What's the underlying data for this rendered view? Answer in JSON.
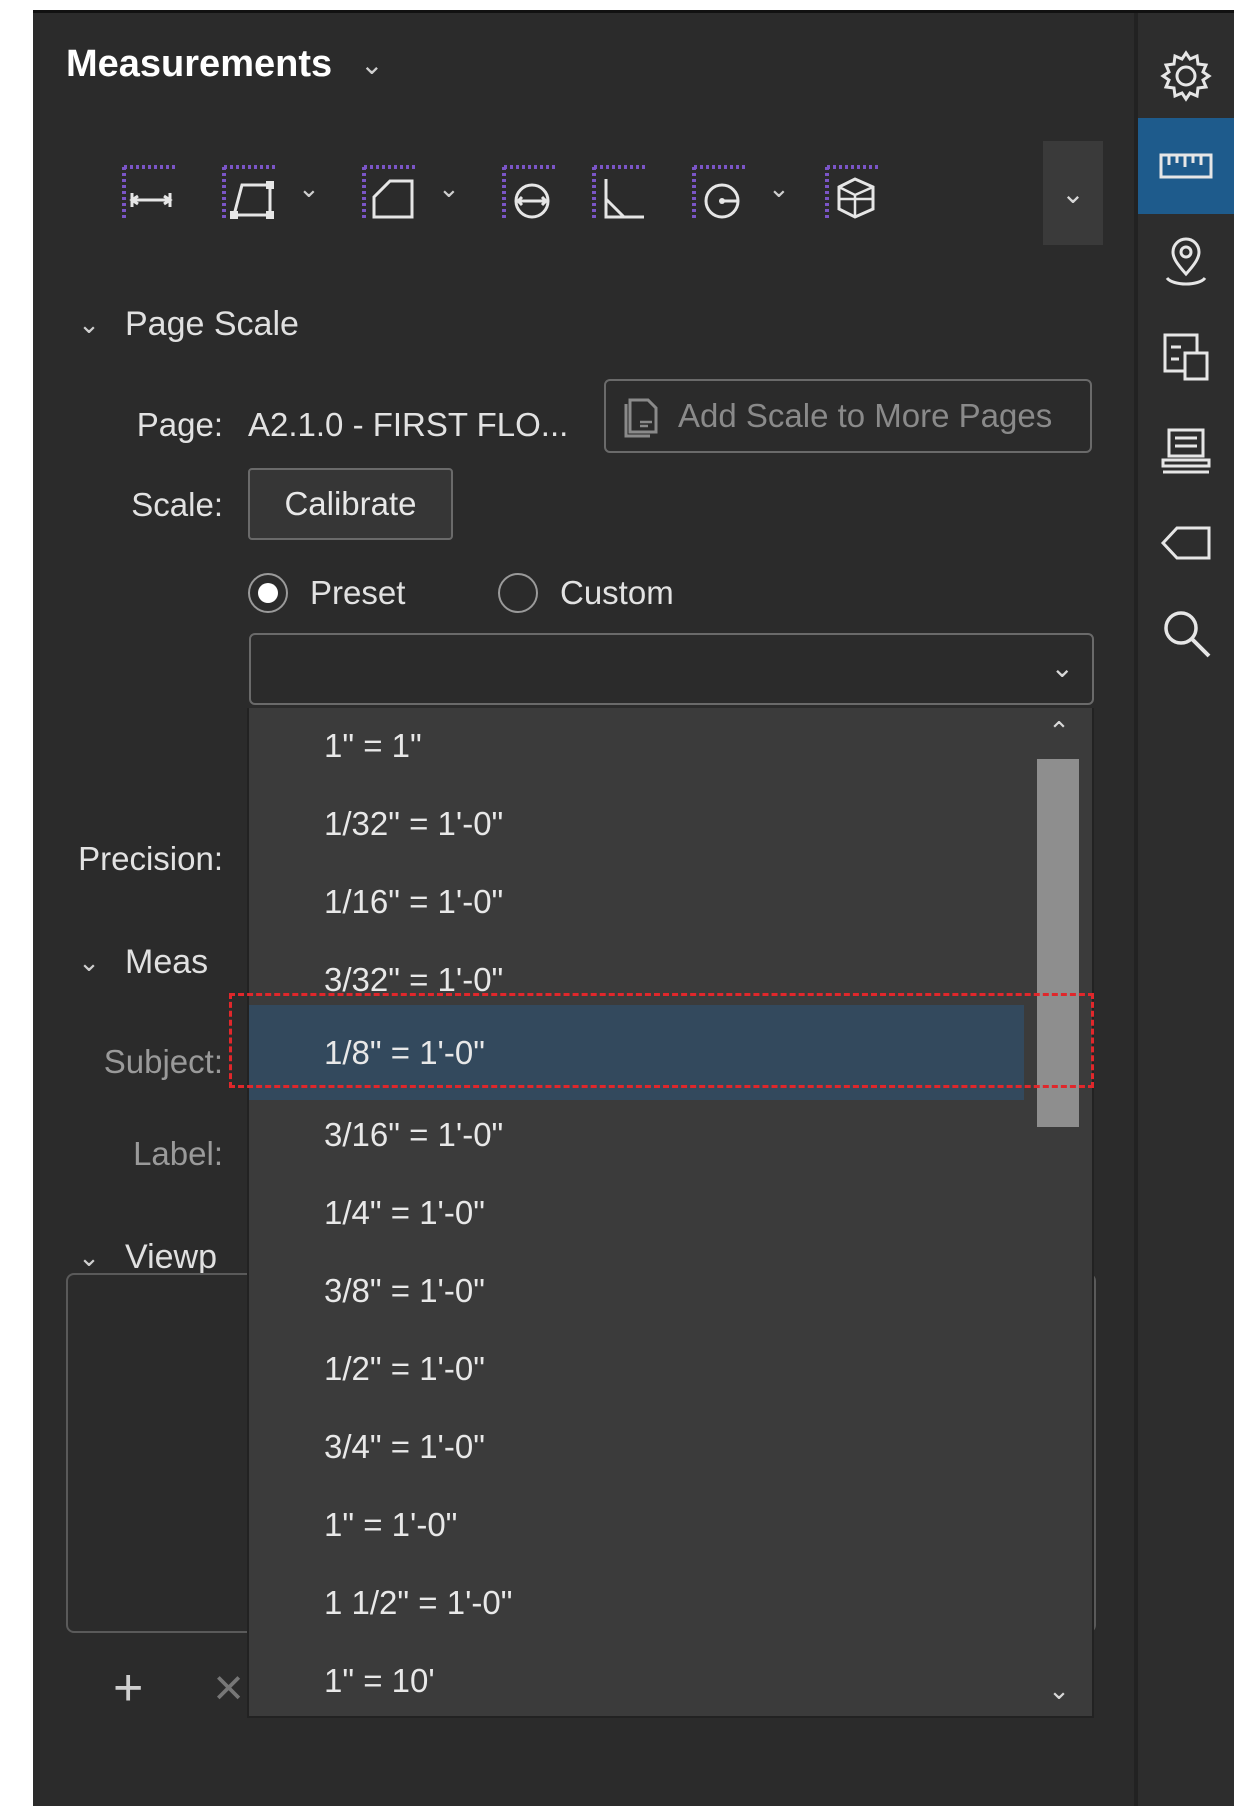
{
  "panel": {
    "title": "Measurements",
    "title_chevron": "⌄"
  },
  "toolbar": {
    "tools": [
      {
        "icon": "length-icon"
      },
      {
        "icon": "polylength-icon"
      },
      {
        "icon": "area-icon"
      },
      {
        "icon": "diameter-icon"
      },
      {
        "icon": "angle-icon"
      },
      {
        "icon": "circle-icon"
      },
      {
        "icon": "volume-icon"
      }
    ],
    "dropdown_glyph": "⌄",
    "more_glyph": "⌄"
  },
  "page_scale": {
    "section_label": "Page Scale",
    "page_label": "Page:",
    "page_value": "A2.1.0 - FIRST FLO...",
    "add_scale_label": "Add Scale to More Pages",
    "scale_label": "Scale:",
    "calibrate_label": "Calibrate",
    "preset_label": "Preset",
    "custom_label": "Custom",
    "selected_mode": "Preset",
    "select_value": "",
    "precision_label": "Precision:"
  },
  "measurement_section": {
    "section_label": "Meas",
    "subject_label": "Subject:",
    "label_label": "Label:"
  },
  "viewport_section": {
    "section_label": "Viewp"
  },
  "bottom_actions": {
    "add_glyph": "+",
    "remove_glyph": "×"
  },
  "scale_dropdown": {
    "options": [
      "1\" = 1\"",
      "1/32\" = 1'-0\"",
      "1/16\" = 1'-0\"",
      "3/32\" = 1'-0\"",
      "1/8\" = 1'-0\"",
      "3/16\" = 1'-0\"",
      "1/4\" = 1'-0\"",
      "3/8\" = 1'-0\"",
      "1/2\" = 1'-0\"",
      "3/4\" = 1'-0\"",
      "1\" = 1'-0\"",
      "1 1/2\" = 1'-0\"",
      "1\" = 10'"
    ],
    "selected_index": 4,
    "scroll_up_glyph": "⌃",
    "scroll_down_glyph": "⌄"
  },
  "right_rail": {
    "items": [
      {
        "icon": "gear-icon",
        "active": false
      },
      {
        "icon": "ruler-icon",
        "active": true
      },
      {
        "icon": "location-pin-icon",
        "active": false
      },
      {
        "icon": "compare-pages-icon",
        "active": false
      },
      {
        "icon": "stamp-icon",
        "active": false
      },
      {
        "icon": "tag-icon",
        "active": false
      },
      {
        "icon": "search-icon",
        "active": false
      }
    ]
  },
  "colors": {
    "panel_bg": "#2b2b2b",
    "selection_bg": "#33495d",
    "rail_active": "#1e5b8c",
    "tool_accent": "#7b55c7",
    "highlight_border": "#e0272b"
  }
}
